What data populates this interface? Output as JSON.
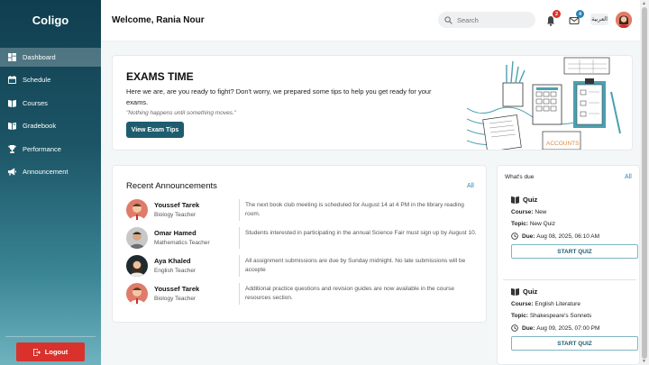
{
  "app": {
    "name": "Coligo"
  },
  "sidebar": {
    "items": [
      {
        "label": "Dashboard",
        "icon": "dashboard-icon"
      },
      {
        "label": "Schedule",
        "icon": "calendar-icon"
      },
      {
        "label": "Courses",
        "icon": "book-icon"
      },
      {
        "label": "Gradebook",
        "icon": "gradebook-icon"
      },
      {
        "label": "Performance",
        "icon": "trophy-icon"
      },
      {
        "label": "Announcement",
        "icon": "megaphone-icon"
      }
    ],
    "active": "Dashboard",
    "logout_label": "Logout"
  },
  "header": {
    "welcome": "Welcome, Rania Nour",
    "search_placeholder": "Search",
    "notifications_count": "2",
    "messages_count": "4",
    "language": "العربية"
  },
  "banner": {
    "title": "EXAMS TIME",
    "text": "Here we are, are you ready to fight? Don't worry, we prepared some tips to help you get ready for your exams.",
    "quote": "\"Nothing happens until something moves.\"",
    "button_label": "View Exam Tips",
    "illustration_label": "ACCOUNTS"
  },
  "announcements": {
    "title": "Recent Announcements",
    "all_label": "All",
    "items": [
      {
        "name": "Youssef Tarek",
        "role": "Biology Teacher",
        "text": "The next book club meeting is scheduled for August 14 at 4 PM in the library reading room."
      },
      {
        "name": "Omar Hamed",
        "role": "Mathematics Teacher",
        "text": "Students interested in participating in the annual Science Fair must sign up by August 10."
      },
      {
        "name": "Aya Khaled",
        "role": "English Teacher",
        "text": "All assignment submissions are due by Sunday midnight. No late submissions will be accepte"
      },
      {
        "name": "Youssef Tarek",
        "role": "Biology Teacher",
        "text": "Additional practice questions and revision guides are now available in the course resources section."
      }
    ]
  },
  "due": {
    "title": "What's due",
    "all_label": "All",
    "items": [
      {
        "type": "Quiz",
        "course_label": "Course:",
        "course": "New",
        "topic_label": "Topic:",
        "topic": "New Quiz",
        "due_label": "Due:",
        "due": "Aug 08, 2025, 06:10 AM",
        "button_label": "START QUIZ"
      },
      {
        "type": "Quiz",
        "course_label": "Course:",
        "course": "English Literature",
        "topic_label": "Topic:",
        "topic": "Shakespeare's Sonnets",
        "due_label": "Due:",
        "due": "Aug 09, 2025, 07:00 PM",
        "button_label": "START QUIZ"
      }
    ]
  },
  "colors": {
    "accent": "#1f5d6e",
    "danger": "#d9322d",
    "link": "#2a86b5"
  }
}
